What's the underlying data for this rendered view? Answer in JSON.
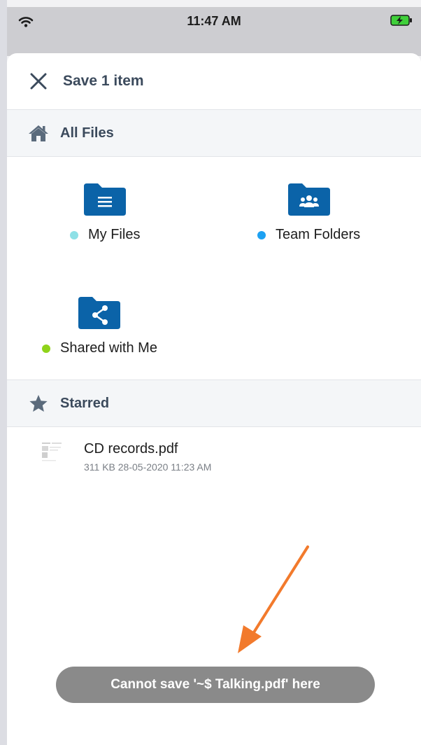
{
  "status_bar": {
    "time": "11:47 AM",
    "wifi_icon": "wifi-icon",
    "battery_icon": "battery-charging-icon"
  },
  "header": {
    "close_icon": "close-icon",
    "title": "Save 1 item"
  },
  "all_files": {
    "icon": "home-icon",
    "label": "All Files",
    "folders": [
      {
        "name": "My Files",
        "icon": "folder-document-icon",
        "dot_color": "#8ee0e6"
      },
      {
        "name": "Team Folders",
        "icon": "folder-team-icon",
        "dot_color": "#1da1f2"
      },
      {
        "name": "Shared with Me",
        "icon": "folder-share-icon",
        "dot_color": "#8fd31a"
      }
    ]
  },
  "starred": {
    "icon": "star-icon",
    "label": "Starred",
    "files": [
      {
        "name": "CD records.pdf",
        "meta": "311 KB 28-05-2020 11:23 AM"
      }
    ]
  },
  "toast": {
    "message": "Cannot save '~$ Talking.pdf' here"
  },
  "colors": {
    "folder_blue": "#0b63a8",
    "header_text": "#3b4a5c",
    "annotation_arrow": "#f27a2c",
    "toast_bg": "#8a8a8a"
  }
}
